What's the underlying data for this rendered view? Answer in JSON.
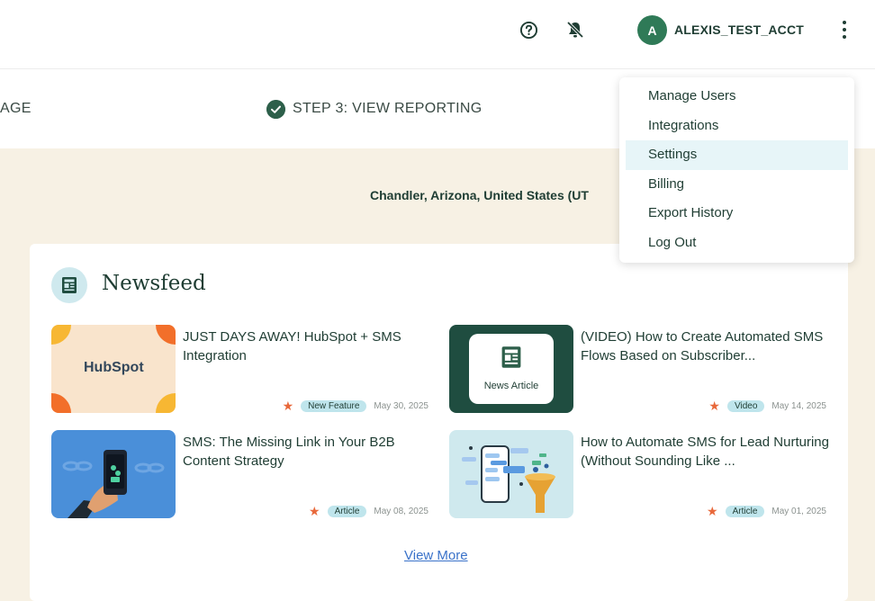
{
  "header": {
    "account_initial": "A",
    "account_name": "ALEXIS_TEST_ACCT",
    "icons": [
      "help-icon",
      "bell-off-icon",
      "kebab-menu-icon"
    ]
  },
  "steps": {
    "prev_partial": "AGE",
    "current": "STEP 3: VIEW REPORTING"
  },
  "location": "Chandler, Arizona, United States (UT",
  "newsfeed": {
    "title": "Newsfeed",
    "items": [
      {
        "title": "JUST DAYS AWAY! HubSpot + SMS Integration",
        "tag": "New Feature",
        "date": "May 30, 2025",
        "thumb": "hubspot-logo"
      },
      {
        "title": "(VIDEO) How to Create Automated SMS Flows Based on Subscriber...",
        "tag": "Video",
        "date": "May 14, 2025",
        "thumb": "news-article",
        "thumb_label": "News Article"
      },
      {
        "title": "SMS: The Missing Link in Your B2B Content Strategy",
        "tag": "Article",
        "date": "May 08, 2025",
        "thumb": "phone-in-hand"
      },
      {
        "title": "How to Automate SMS for Lead Nurturing (Without Sounding Like ...",
        "tag": "Article",
        "date": "May 01, 2025",
        "thumb": "phone-funnel"
      }
    ],
    "hubspot_logo_text": "HubSpot",
    "view_more": "View More"
  },
  "menu": {
    "items": [
      "Manage Users",
      "Integrations",
      "Settings",
      "Billing",
      "Export History",
      "Log Out"
    ],
    "active_index": 2
  },
  "colors": {
    "brand_green": "#2f7a57",
    "dark_green": "#1f3d33",
    "cream": "#f7f1e4",
    "tag_bg": "#bfe5ec",
    "star": "#e8683a",
    "link": "#3a72c9"
  }
}
